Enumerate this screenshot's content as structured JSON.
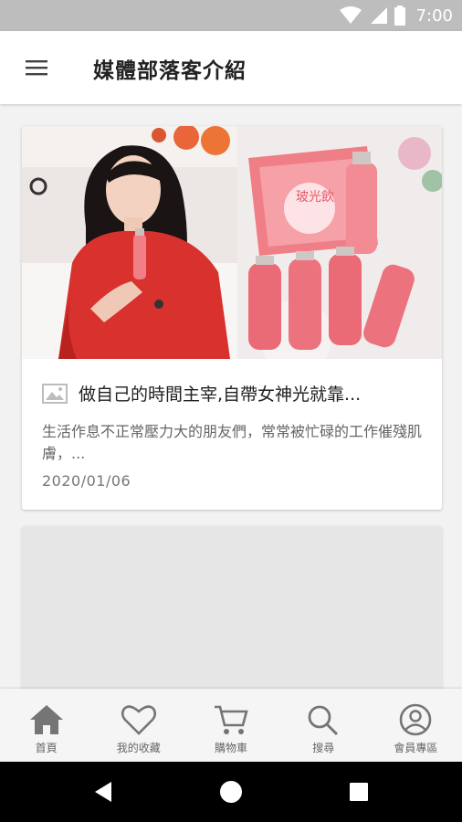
{
  "status_bar": {
    "time": "7:00",
    "icons": [
      "wifi-icon",
      "cellular-signal-icon",
      "battery-icon"
    ]
  },
  "app_bar": {
    "title": "媒體部落客介紹",
    "menu_icon": "hamburger-menu-icon"
  },
  "posts": [
    {
      "title": "做自己的時間主宰,自帶女神光就靠...",
      "excerpt": "生活作息不正常壓力大的朋友們，常常被忙碌的工作催殘肌膚，...",
      "date": "2020/01/06",
      "image_icon": "image-icon",
      "product_label": "玻光飲"
    }
  ],
  "bottom_nav": {
    "items": [
      {
        "label": "首頁",
        "icon": "home-icon"
      },
      {
        "label": "我的收藏",
        "icon": "heart-icon"
      },
      {
        "label": "購物車",
        "icon": "cart-icon"
      },
      {
        "label": "搜尋",
        "icon": "search-icon"
      },
      {
        "label": "會員專區",
        "icon": "user-icon"
      }
    ]
  },
  "system_nav": [
    "back-icon",
    "home-circle-icon",
    "recents-icon"
  ],
  "colors": {
    "status_bar": "#bdbdbd",
    "app_bar": "#ffffff",
    "background": "#f2f2f2",
    "nav_icon": "#757575",
    "accent_red": "#d83a3a",
    "accent_pink": "#f08a8a"
  }
}
